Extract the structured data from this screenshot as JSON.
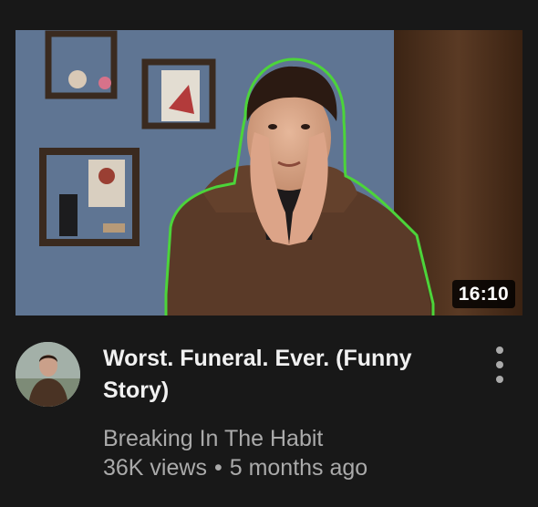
{
  "video": {
    "title": "Worst. Funeral. Ever. (Funny Story)",
    "duration": "16:10",
    "channel": "Breaking In The Habit",
    "views": "36K views",
    "separator": "•",
    "age": "5 months ago"
  },
  "icons": {
    "menu": "more-vertical-icon"
  },
  "colors": {
    "background": "#181818",
    "title": "#f1f1f1",
    "secondary": "#aaaaaa",
    "outline_accent": "#4cd43a"
  }
}
